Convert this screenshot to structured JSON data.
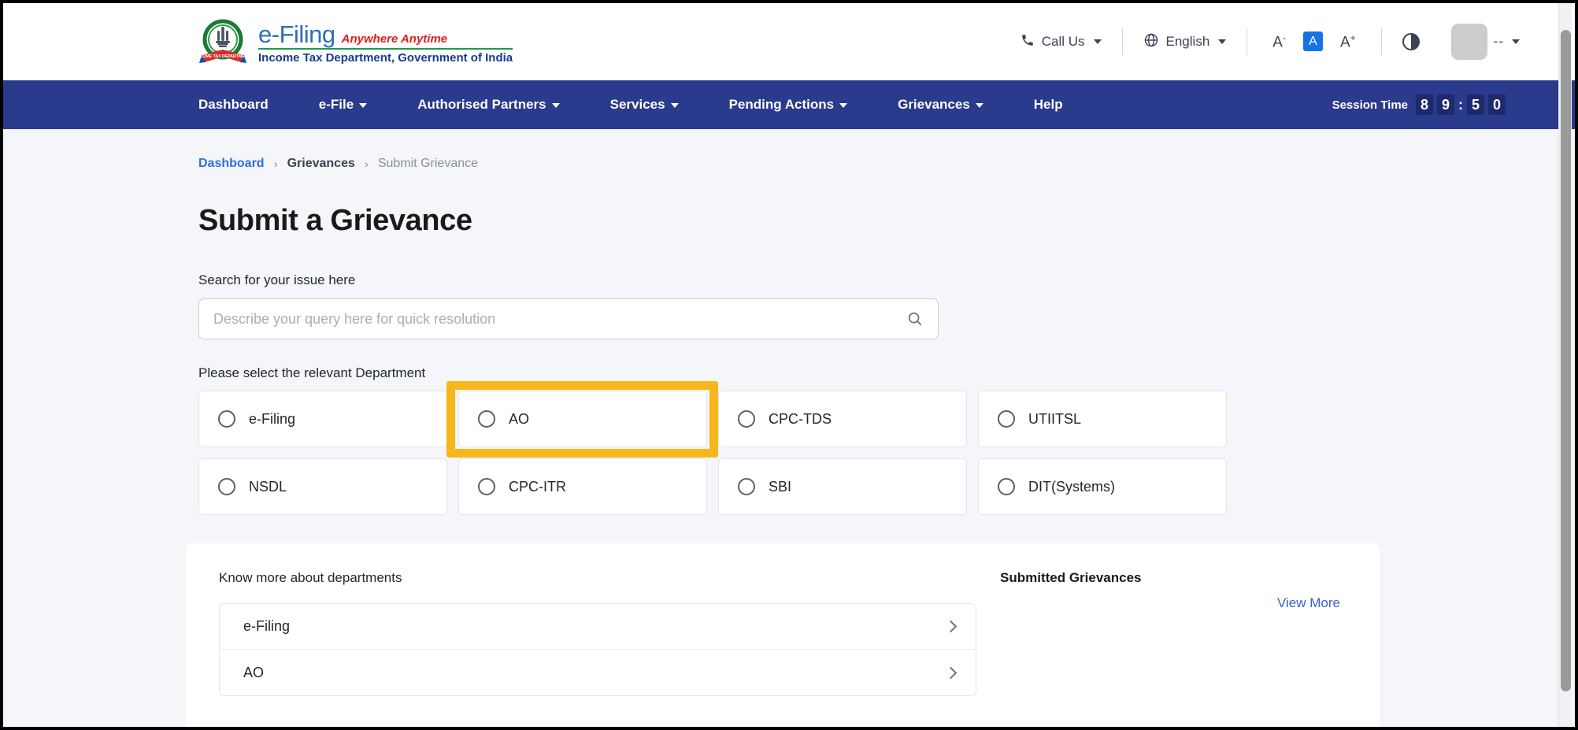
{
  "header": {
    "brand": {
      "emblem_icon": "india-emblem-icon",
      "title": "e-Filing",
      "tagline": "Anywhere Anytime",
      "subtitle": "Income Tax Department, Government of India"
    },
    "call_us": {
      "icon": "phone-icon",
      "label": "Call Us"
    },
    "language": {
      "icon": "globe-icon",
      "label": "English"
    },
    "font_size": {
      "decrease": "A",
      "decrease_sup": "-",
      "normal": "A",
      "increase": "A",
      "increase_sup": "+"
    },
    "contrast_icon": "contrast-icon",
    "user": {
      "avatar_icon": "avatar-placeholder-icon",
      "label": "--"
    }
  },
  "nav": {
    "items": [
      {
        "label": "Dashboard",
        "has_caret": false
      },
      {
        "label": "e-File",
        "has_caret": true
      },
      {
        "label": "Authorised Partners",
        "has_caret": true
      },
      {
        "label": "Services",
        "has_caret": true
      },
      {
        "label": "Pending Actions",
        "has_caret": true
      },
      {
        "label": "Grievances",
        "has_caret": true
      },
      {
        "label": "Help",
        "has_caret": false
      }
    ],
    "session": {
      "label": "Session Time",
      "digits": [
        "8",
        "9",
        "5",
        "0"
      ],
      "separator": ":"
    }
  },
  "breadcrumb": {
    "items": [
      {
        "label": "Dashboard",
        "current": false
      },
      {
        "label": "Grievances",
        "current": false
      },
      {
        "label": "Submit Grievance",
        "current": true
      }
    ],
    "separator": "›"
  },
  "page": {
    "title": "Submit a Grievance",
    "search": {
      "label": "Search for your issue here",
      "placeholder": "Describe your query here for quick resolution",
      "value": "",
      "icon": "search-icon"
    },
    "department": {
      "label": "Please select the relevant Department",
      "options": [
        {
          "label": "e-Filing",
          "selected": false,
          "highlighted": false
        },
        {
          "label": "AO",
          "selected": false,
          "highlighted": true
        },
        {
          "label": "CPC-TDS",
          "selected": false,
          "highlighted": false
        },
        {
          "label": "UTIITSL",
          "selected": false,
          "highlighted": false
        },
        {
          "label": "NSDL",
          "selected": false,
          "highlighted": false
        },
        {
          "label": "CPC-ITR",
          "selected": false,
          "highlighted": false
        },
        {
          "label": "SBI",
          "selected": false,
          "highlighted": false
        },
        {
          "label": "DIT(Systems)",
          "selected": false,
          "highlighted": false
        }
      ],
      "highlight_color": "#f5b71c"
    },
    "know_more": {
      "heading": "Know more about departments",
      "rows": [
        {
          "label": "e-Filing",
          "chevron": "chevron-right-icon"
        },
        {
          "label": "AO",
          "chevron": "chevron-right-icon"
        }
      ]
    },
    "submitted_grievances": {
      "title": "Submitted Grievances",
      "view_more": "View More"
    }
  },
  "colors": {
    "nav_bg": "#2a3a8c",
    "page_bg": "#f4f6fa",
    "accent_blue": "#2f6fe0",
    "highlight": "#f5b71c",
    "green_rule": "#1a9c4a",
    "red_tagline": "#e02020"
  }
}
